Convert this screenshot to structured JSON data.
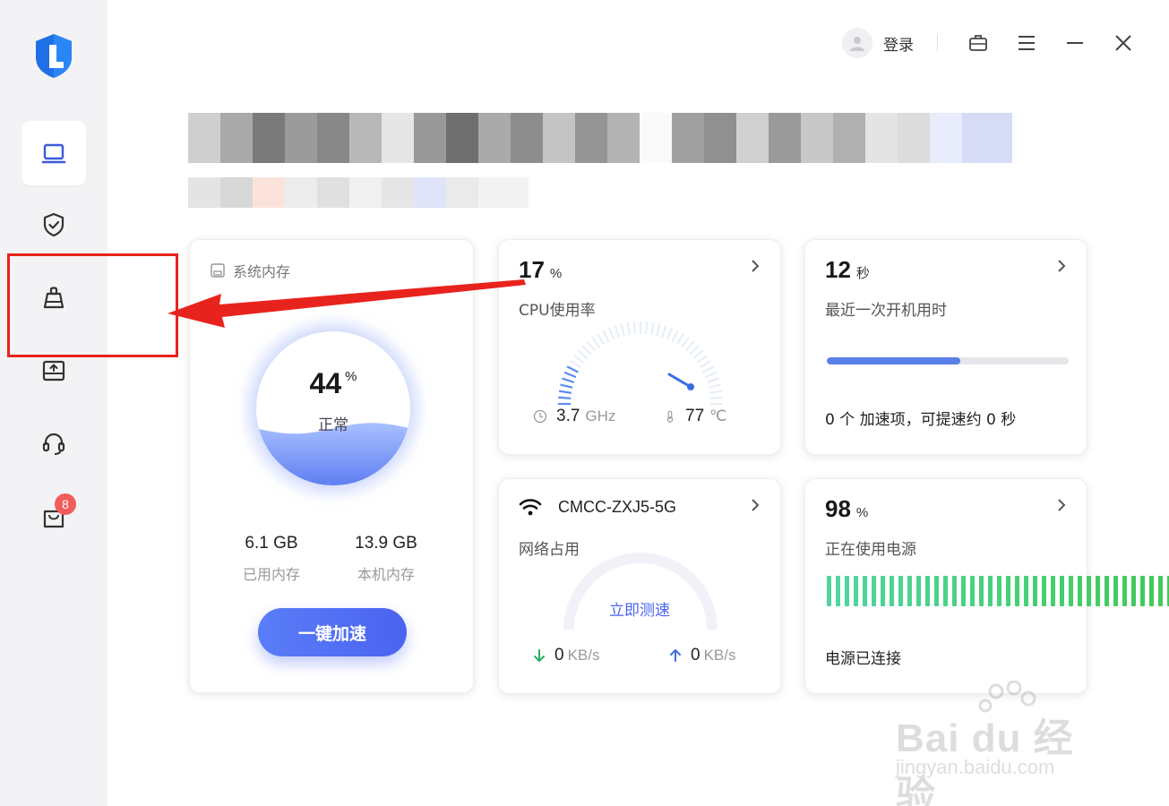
{
  "header": {
    "login_label": "登录",
    "icons": [
      "avatar-icon",
      "toolbox-icon",
      "menu-icon",
      "minimize-icon",
      "close-icon"
    ]
  },
  "sidebar": {
    "items": [
      {
        "name": "computer",
        "icon": "laptop-icon",
        "active": true
      },
      {
        "name": "security",
        "icon": "shield-check-icon"
      },
      {
        "name": "cleanup",
        "icon": "broom-icon"
      },
      {
        "name": "drive",
        "icon": "disk-upload-icon"
      },
      {
        "name": "support",
        "icon": "headset-icon"
      },
      {
        "name": "store",
        "icon": "bag-icon",
        "badge": "8"
      }
    ]
  },
  "memory": {
    "title": "系统内存",
    "percent": "44",
    "unit": "%",
    "percent_value": 44,
    "status": "正常",
    "used": "6.1 GB",
    "used_label": "已用内存",
    "total": "13.9 GB",
    "total_label": "本机内存",
    "boost_button": "一键加速"
  },
  "cpu": {
    "value": "17",
    "unit": "%",
    "label": "CPU使用率",
    "usage_value": 17,
    "freq": "3.7",
    "freq_unit": "GHz",
    "temp": "77",
    "temp_unit": "℃"
  },
  "boot": {
    "value": "12",
    "unit": "秒",
    "label": "最近一次开机用时",
    "progress_fraction": 0.55,
    "note": "0 个 加速项，可提速约 0 秒"
  },
  "network": {
    "ssid": "CMCC-ZXJ5-5G",
    "label": "网络占用",
    "speedtest": "立即测速",
    "down": "0",
    "down_unit": "KB/s",
    "up": "0",
    "up_unit": "KB/s"
  },
  "power": {
    "value": "98",
    "unit": "%",
    "label": "正在使用电源",
    "level_fraction": 0.98,
    "status": "电源已连接"
  },
  "colors": {
    "accent": "#4a63f0",
    "annotation_red": "#e8231d",
    "battery_start": "#4fd6a0",
    "battery_end": "#3ec74a"
  },
  "watermark": {
    "brand": "Bai du 经验",
    "url": "jingyan.baidu.com"
  }
}
